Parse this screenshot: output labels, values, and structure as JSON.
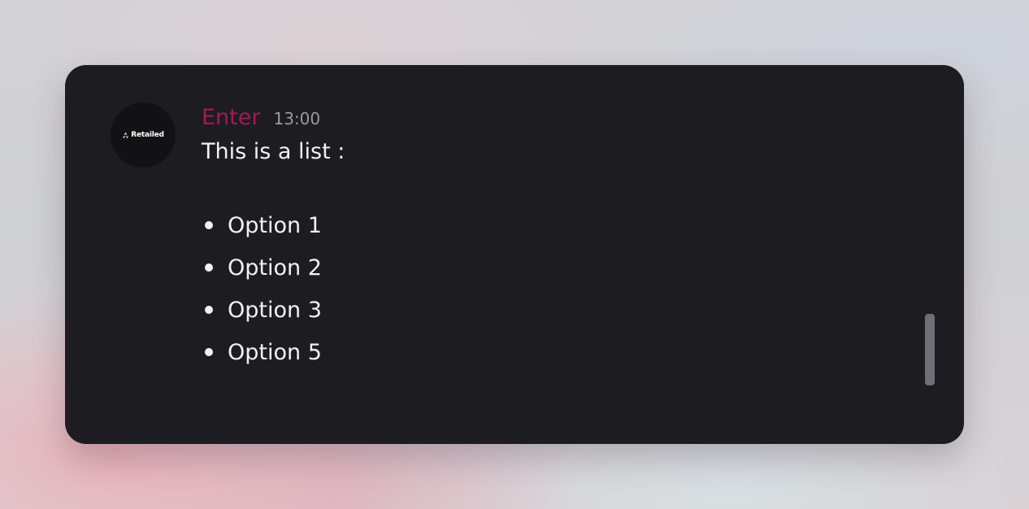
{
  "message": {
    "author": "Enter",
    "time": "13:00",
    "author_color": "#a01c53",
    "text": "This is a list :",
    "items": [
      "Option 1",
      "Option 2",
      "Option 3",
      "Option 5"
    ]
  },
  "avatar": {
    "logo_text": "Retailed",
    "icon": "recycle-icon"
  },
  "theme": {
    "card_background": "#1d1c21",
    "text_color": "#f1f1f3",
    "timestamp_color": "#9a9aa0"
  }
}
